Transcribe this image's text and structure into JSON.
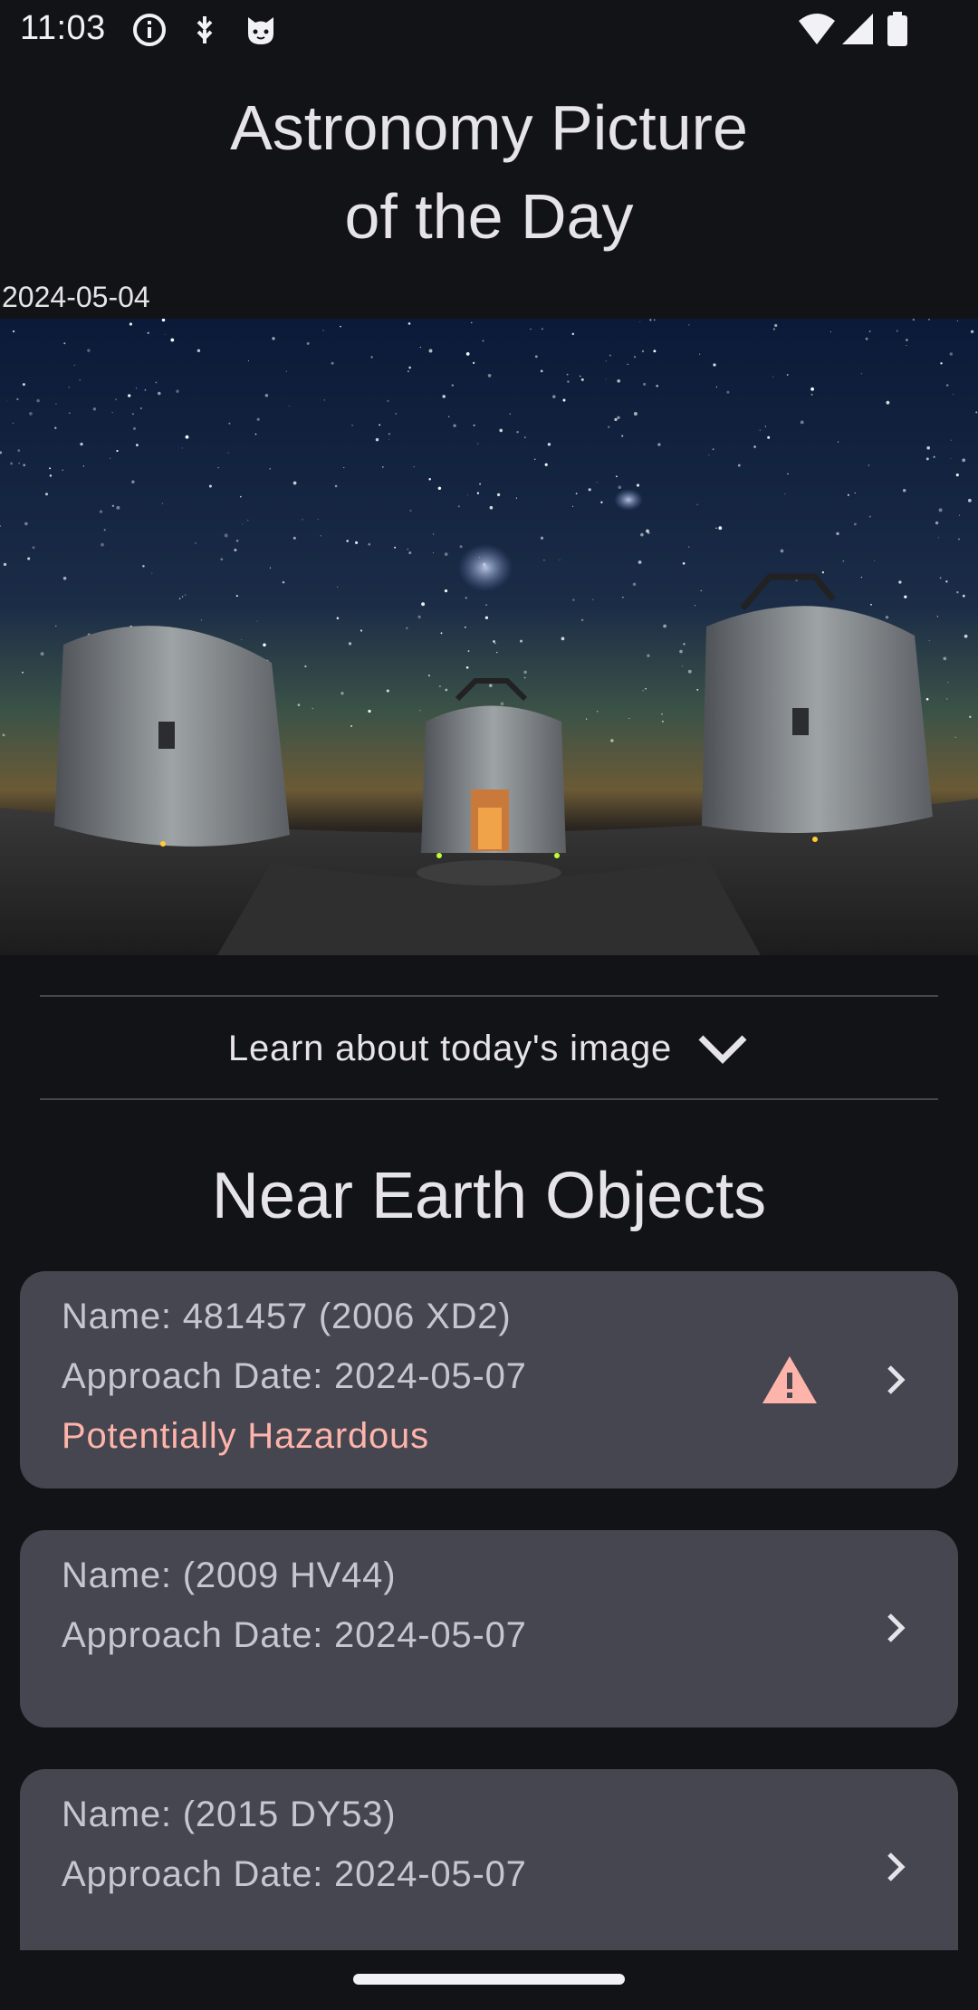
{
  "status_bar": {
    "time": "11:03",
    "icons": [
      "info-icon",
      "download-arrows-icon",
      "cat-face-icon"
    ],
    "right_icons": [
      "wifi-icon",
      "cellular-signal-icon",
      "battery-icon"
    ]
  },
  "header": {
    "title_line1": "Astronomy Picture",
    "title_line2": "of the Day",
    "date": "2024-05-04"
  },
  "apod": {
    "image_description_icon": "telescope-night-sky-photo",
    "learn_label": "Learn about today's image",
    "learn_icon": "chevron-down-icon"
  },
  "neo_section": {
    "title": "Near Earth Objects",
    "items": [
      {
        "name": "Name: 481457 (2006 XD2)",
        "approach": "Approach Date: 2024-05-07",
        "hazard": "Potentially Hazardous",
        "is_hazardous": true
      },
      {
        "name": "Name: (2009 HV44)",
        "approach": "Approach Date: 2024-05-07",
        "is_hazardous": false
      },
      {
        "name": "Name: (2015 DY53)",
        "approach": "Approach Date: 2024-05-07",
        "is_hazardous": false
      }
    ]
  },
  "colors": {
    "background": "#121317",
    "card": "#45464f",
    "hazard": "#ffb4ab",
    "text": "#e6e4ea"
  }
}
